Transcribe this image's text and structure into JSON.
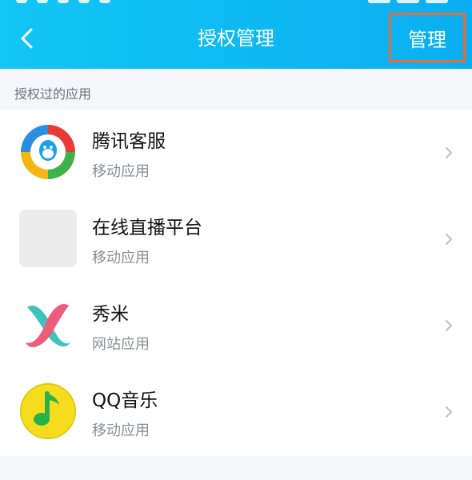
{
  "header": {
    "title": "授权管理",
    "manage_label": "管理",
    "background_color": "#12c0f4",
    "highlight_color": "#ee6a2d"
  },
  "section": {
    "label": "授权过的应用"
  },
  "apps": [
    {
      "name": "腾讯客服",
      "type": "移动应用",
      "icon": "tencent-service-icon"
    },
    {
      "name": "在线直播平台",
      "type": "移动应用",
      "icon": "placeholder-icon"
    },
    {
      "name": "秀米",
      "type": "网站应用",
      "icon": "xiumi-icon"
    },
    {
      "name": "QQ音乐",
      "type": "移动应用",
      "icon": "qq-music-icon"
    }
  ]
}
